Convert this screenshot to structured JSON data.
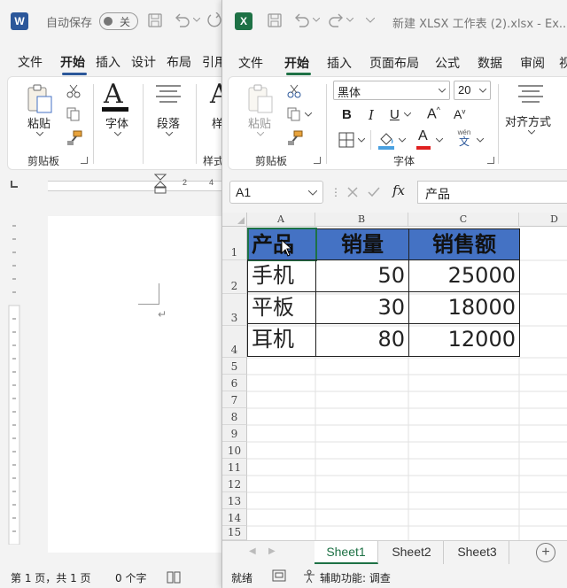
{
  "word": {
    "autosave_label": "自动保存",
    "autosave_state": "关",
    "tabs": [
      "文件",
      "开始",
      "插入",
      "设计",
      "布局",
      "引用"
    ],
    "groups": {
      "paste_label": "粘贴",
      "clipboard_label": "剪贴板",
      "font_label": "字体",
      "paragraph_label": "段落",
      "style_label": "样式",
      "style_label_short": "样"
    },
    "ruler_nums": [
      "2",
      "4"
    ],
    "status": {
      "page": "第 1 页，共 1 页",
      "words": "0 个字"
    }
  },
  "excel": {
    "title": "新建 XLSX 工作表 (2).xlsx  -  Ex...",
    "tabs": [
      "文件",
      "开始",
      "插入",
      "页面布局",
      "公式",
      "数据",
      "审阅",
      "视"
    ],
    "ribbon": {
      "paste_label": "粘贴",
      "clipboard_label": "剪贴板",
      "font_name": "黑体",
      "font_size": "20",
      "font_label": "字体",
      "align_label": "对齐方式",
      "bold": "B",
      "italic": "I",
      "underline": "U",
      "grow": "A",
      "shrink": "A",
      "color_a": "A",
      "wen": "wén",
      "wen_char": "文"
    },
    "name_box": "A1",
    "fx": "fx",
    "formula_value": "产品",
    "columns": [
      "A",
      "B",
      "C",
      "D"
    ],
    "rows": [
      "1",
      "2",
      "3",
      "4",
      "5",
      "6",
      "7",
      "8",
      "9",
      "10",
      "11",
      "12",
      "13",
      "14",
      "15"
    ],
    "table": {
      "headers": [
        "产品",
        "销量",
        "销售额"
      ],
      "rows": [
        [
          "手机",
          "50",
          "25000"
        ],
        [
          "平板",
          "30",
          "18000"
        ],
        [
          "耳机",
          "80",
          "12000"
        ]
      ]
    },
    "sheets": [
      "Sheet1",
      "Sheet2",
      "Sheet3"
    ],
    "status": {
      "ready": "就绪",
      "accessibility": "辅助功能: 调查"
    },
    "colors": {
      "header_fill": "#4472c4",
      "brand_green": "#1e7145"
    }
  }
}
